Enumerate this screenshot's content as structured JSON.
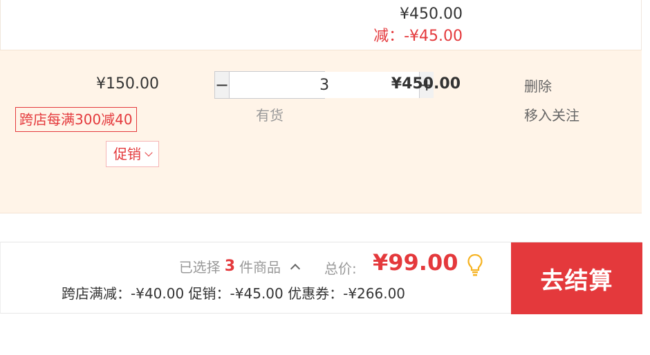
{
  "previous_item": {
    "subtotal": "¥450.00",
    "discount": "减：-¥45.00"
  },
  "item": {
    "unit_price": "¥150.00",
    "promo_tag": "跨店每满300减40",
    "promo_dropdown": "促销",
    "quantity": "3",
    "minus_label": "−",
    "plus_label": "+",
    "stock_status": "有货",
    "subtotal": "¥450.00",
    "delete_label": "删除",
    "follow_label": "移入关注"
  },
  "footer": {
    "selected_prefix": "已选择",
    "selected_count": "3",
    "selected_suffix": "件商品",
    "total_label": "总价:",
    "total_value": "¥99.00",
    "discount_line": "跨店满减：-¥40.00 促销：-¥45.00 优惠券：-¥266.00",
    "checkout_label": "去结算",
    "bulb_icon": "lightbulb-icon"
  },
  "colors": {
    "accent": "#e4393c",
    "row_bg": "#fff4e8",
    "bulb": "#f6b322"
  }
}
